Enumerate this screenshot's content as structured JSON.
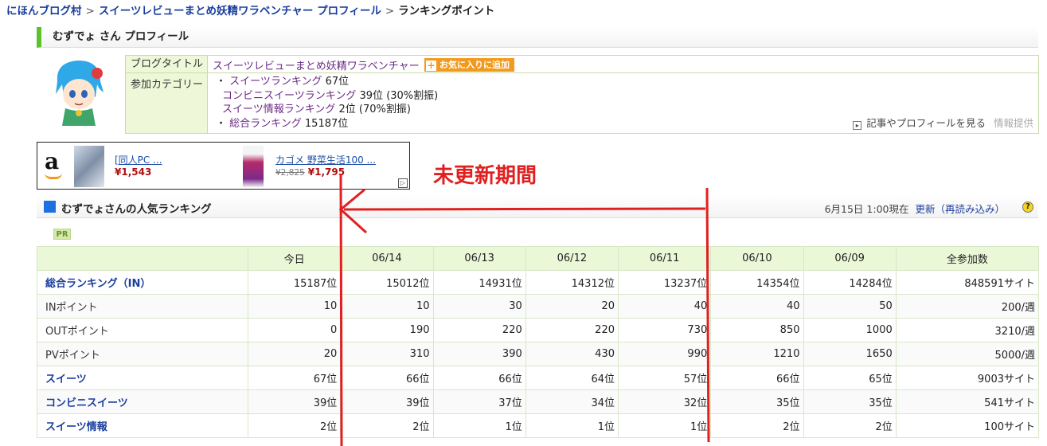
{
  "breadcrumb": {
    "home": "にほんブログ村",
    "profile": "スイーツレビューまとめ妖精ワラベンチャー プロフィール",
    "current": "ランキングポイント",
    "separator": ">"
  },
  "profile": {
    "header": "むずでょ さん プロフィール",
    "blog_title_label": "ブログタイトル",
    "blog_title": "スイーツレビューまとめ妖精ワラベンチャー",
    "favorite_button": "お気に入りに追加",
    "category_label": "参加カテゴリー",
    "categories": [
      {
        "prefix": "・ ",
        "name": "スイーツランキング",
        "rank": "67位",
        "note": ""
      },
      {
        "prefix": "",
        "name": "コンビニスイーツランキング",
        "rank": "39位",
        "note": "(30%割振)"
      },
      {
        "prefix": "",
        "name": "スイーツ情報ランキング",
        "rank": "2位",
        "note": "(70%割振)"
      },
      {
        "prefix": "・ ",
        "name": "総合ランキング",
        "rank": "15187位",
        "note": ""
      }
    ],
    "more_link": "記事やプロフィールを見る",
    "info_link": "情報提供"
  },
  "ad": {
    "item1_title": "[同人PC ...",
    "item1_price": "¥1,543",
    "item2_title": "カゴメ 野菜生活100 ...",
    "item2_old_price": "¥2,825",
    "item2_price": "¥1,795"
  },
  "ranking": {
    "header": "むずでょさんの人気ランキング",
    "timestamp": "6月15日 1:00現在",
    "refresh": "更新（再読み込み）",
    "pr": "PR",
    "columns": [
      "",
      "今日",
      "06/14",
      "06/13",
      "06/12",
      "06/11",
      "06/10",
      "06/09",
      "全参加数"
    ],
    "rows": [
      {
        "label": "総合ランキング（IN）",
        "link": true,
        "values": [
          "15187位",
          "15012位",
          "14931位",
          "14312位",
          "13237位",
          "14354位",
          "14284位",
          "848591サイト"
        ]
      },
      {
        "label": "INポイント",
        "link": false,
        "values": [
          "10",
          "10",
          "30",
          "20",
          "40",
          "40",
          "50",
          "200/週"
        ]
      },
      {
        "label": "OUTポイント",
        "link": false,
        "values": [
          "0",
          "190",
          "220",
          "220",
          "730",
          "850",
          "1000",
          "3210/週"
        ]
      },
      {
        "label": "PVポイント",
        "link": false,
        "values": [
          "20",
          "310",
          "390",
          "430",
          "990",
          "1210",
          "1650",
          "5000/週"
        ]
      },
      {
        "label": "スイーツ",
        "link": true,
        "values": [
          "67位",
          "66位",
          "66位",
          "64位",
          "57位",
          "66位",
          "65位",
          "9003サイト"
        ]
      },
      {
        "label": "コンビニスイーツ",
        "link": true,
        "values": [
          "39位",
          "39位",
          "37位",
          "34位",
          "32位",
          "35位",
          "35位",
          "541サイト"
        ]
      },
      {
        "label": "スイーツ情報",
        "link": true,
        "values": [
          "2位",
          "2位",
          "1位",
          "1位",
          "1位",
          "2位",
          "2位",
          "100サイト"
        ]
      }
    ]
  },
  "annotation": {
    "text": "未更新期間",
    "color": "#e02020"
  }
}
